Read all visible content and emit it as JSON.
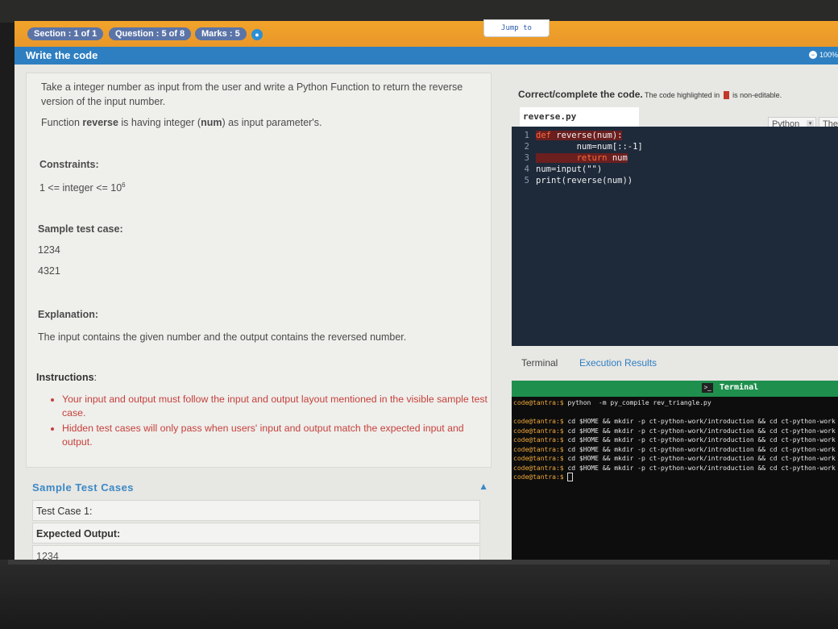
{
  "header": {
    "section": "Section : 1 of 1",
    "question": "Question : 5 of 8",
    "marks": "Marks : 5",
    "jump_to": "Jump to",
    "title": "Write the code",
    "zoom": "100%"
  },
  "problem": {
    "statement_1": "Take a integer number as input from the user and write a Python Function to return the reverse",
    "statement_2": "version of the input number.",
    "statement_3_pre": "Function ",
    "statement_3_fn": "reverse",
    "statement_3_mid": " is having integer (",
    "statement_3_param": "num",
    "statement_3_post": ") as input parameter's.",
    "constraints_label": "Constraints:",
    "constraint_text": "1 <= integer <= 10",
    "constraint_exp": "6",
    "sample_label": "Sample test case:",
    "sample_input": "1234",
    "sample_output": "4321",
    "explanation_label": "Explanation:",
    "explanation_text": "The input contains the given number and the output contains the reversed number.",
    "instructions_label": "Instructions",
    "instructions_colon": ":",
    "instructions": [
      "Your input and output must follow the input and output layout mentioned in the visible sample test case.",
      "Hidden test cases will only pass when users' input and output match the expected input and output."
    ]
  },
  "sample_cases": {
    "heading": "Sample Test Cases",
    "test_case_label": "Test Case 1:",
    "expected_output_label": "Expected Output:",
    "expected_output_value": "1234"
  },
  "editor": {
    "instruction_bold": "Correct/complete the code.",
    "instruction_small_1": " The code highlighted in ",
    "instruction_small_2": " is non-editable.",
    "filename": "reverse.py",
    "language": "Python",
    "theme": "The",
    "lines": [
      {
        "n": "1",
        "kw": "def ",
        "rest": "reverse(num):",
        "readonly": true
      },
      {
        "n": "2",
        "kw": "",
        "rest": "        num=num[::-1]",
        "readonly": false
      },
      {
        "n": "3",
        "kw": "        return ",
        "rest": "num",
        "readonly": true
      },
      {
        "n": "4",
        "kw": "",
        "rest": "num=input(\"\")",
        "readonly": false
      },
      {
        "n": "5",
        "kw": "",
        "rest": "print(reverse(num))",
        "readonly": false
      }
    ]
  },
  "terminal": {
    "tab_terminal": "Terminal",
    "tab_results": "Execution Results",
    "bar_title": "Terminal",
    "prompt": "code@tantra:$",
    "first_cmd": " python  -m py_compile rev_triangle.py",
    "repeat_cmd": " cd $HOME && mkdir -p ct-python-work/introduction && cd ct-python-work",
    "repeat_count": "6"
  },
  "colors": {
    "orange_bar": "#f2a42a",
    "blue_bar": "#2e7fc1",
    "terminal_green": "#1f8f4e",
    "instruction_red": "#c5413a"
  }
}
